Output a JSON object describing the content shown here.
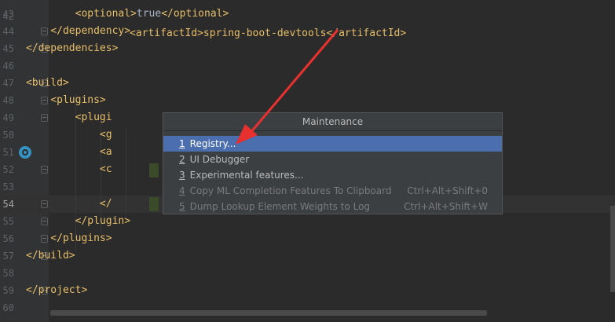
{
  "editor": {
    "lines": [
      {
        "num": "43",
        "code": "        <optional>true</optional>"
      },
      {
        "num": "44",
        "code": "    </dependency>"
      },
      {
        "num": "45",
        "code": "</dependencies>"
      },
      {
        "num": "46",
        "code": ""
      },
      {
        "num": "47",
        "code": "<build>"
      },
      {
        "num": "48",
        "code": "    <plugins>"
      },
      {
        "num": "49",
        "code": "        <plugi"
      },
      {
        "num": "50",
        "code": "            <g"
      },
      {
        "num": "51",
        "code": "            <a"
      },
      {
        "num": "52",
        "code": "            <c"
      },
      {
        "num": "53",
        "code": ""
      },
      {
        "num": "54",
        "code": "            </"
      },
      {
        "num": "55",
        "code": "        </plugin>"
      },
      {
        "num": "56",
        "code": "    </plugins>"
      },
      {
        "num": "57",
        "code": "</build>"
      },
      {
        "num": "58",
        "code": ""
      },
      {
        "num": "59",
        "code": "</project>"
      },
      {
        "num": "60",
        "code": ""
      }
    ],
    "partial_top_line": "<artifactId>spring-boot-devtools</artifactId>"
  },
  "popup": {
    "title": "Maintenance",
    "items": [
      {
        "num": "1",
        "label": "Registry...",
        "shortcut": ""
      },
      {
        "num": "2",
        "label": "UI Debugger",
        "shortcut": ""
      },
      {
        "num": "3",
        "label": "Experimental features...",
        "shortcut": ""
      },
      {
        "num": "4",
        "label": "Copy ML Completion Features To Clipboard",
        "shortcut": "Ctrl+Alt+Shift+0"
      },
      {
        "num": "5",
        "label": "Dump Lookup Element Weights to Log",
        "shortcut": "Ctrl+Alt+Shift+W"
      }
    ]
  },
  "colors": {
    "background": "#2b2b2b",
    "tag": "#e8bf6a",
    "text": "#a9b7c6",
    "selection": "#4b6eaf",
    "arrow": "#e8312f"
  }
}
